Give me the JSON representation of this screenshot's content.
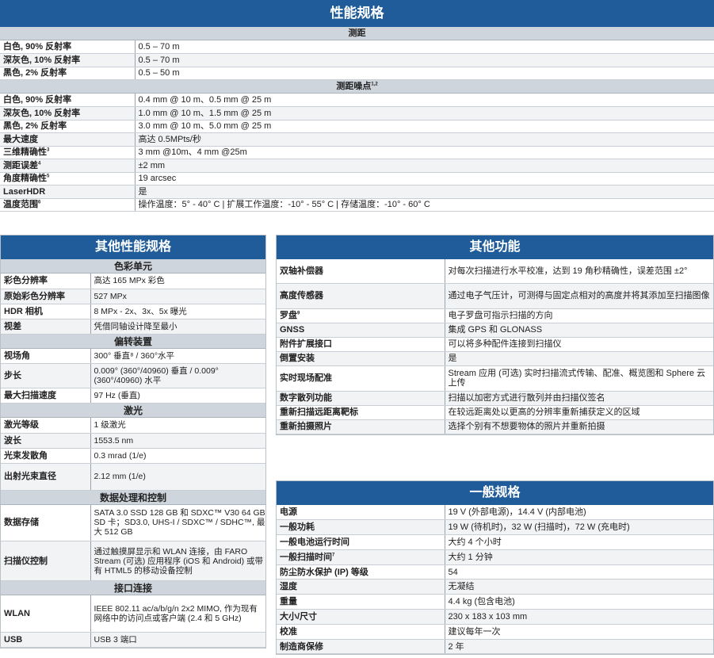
{
  "performance": {
    "title": "性能规格",
    "range_header": "测距",
    "range_rows": [
      {
        "k": "白色, 90% 反射率",
        "v": "0.5 – 70 m"
      },
      {
        "k": "深灰色, 10% 反射率",
        "v": "0.5 – 70 m"
      },
      {
        "k": "黑色, 2% 反射率",
        "v": "0.5 – 50 m"
      }
    ],
    "noise_header": "测距噪点",
    "noise_sup": "1,2",
    "noise_rows": [
      {
        "k": "白色, 90% 反射率",
        "v": "0.4 mm @ 10 m、0.5 mm @ 25 m"
      },
      {
        "k": "深灰色, 10% 反射率",
        "v": "1.0 mm @ 10 m、1.5 mm @ 25 m"
      },
      {
        "k": "黑色, 2% 反射率",
        "v": "3.0 mm @ 10 m、5.0 mm @ 25 m"
      }
    ],
    "misc_rows": [
      {
        "k": "最大速度",
        "sup": "",
        "v": "高达 0.5MPts/秒"
      },
      {
        "k": "三维精确性",
        "sup": "3",
        "v": "3 mm @10m、4 mm @25m"
      },
      {
        "k": "测距误差",
        "sup": "4",
        "v": "±2 mm"
      },
      {
        "k": "角度精确性",
        "sup": "5",
        "v": "19 arcsec"
      },
      {
        "k": "LaserHDR",
        "sup": "",
        "v": "是"
      },
      {
        "k": "温度范围",
        "sup": "6",
        "v": "操作温度：5° - 40° C | 扩展工作温度：-10° - 55° C | 存储温度：-10° - 60° C"
      }
    ]
  },
  "other_perf": {
    "title": "其他性能规格",
    "sections": [
      {
        "header": "色彩单元",
        "rows": [
          {
            "k": "彩色分辨率",
            "v": "高达 165 MPx 彩色"
          },
          {
            "k": "原始彩色分辨率",
            "v": "527 MPx"
          },
          {
            "k": "HDR 相机",
            "v": "8 MPx - 2x、3x、5x 曝光"
          },
          {
            "k": "视差",
            "v": "凭借同轴设计降至最小"
          }
        ]
      },
      {
        "header": "偏转装置",
        "rows": [
          {
            "k": "视场角",
            "v": "300° 垂直⁸ / 360°水平"
          },
          {
            "k": "步长",
            "v": "0.009° (360°/40960) 垂直 / 0.009° (360°/40960) 水平"
          },
          {
            "k": "最大扫描速度",
            "v": "97 Hz (垂直)"
          }
        ]
      },
      {
        "header": "激光",
        "rows": [
          {
            "k": "激光等级",
            "v": "1 级激光"
          },
          {
            "k": "波长",
            "v": "1553.5 nm"
          },
          {
            "k": "光束发散角",
            "v": "0.3 mrad (1/e)"
          },
          {
            "k": "出射光束直径",
            "v": "2.12 mm (1/e)"
          }
        ]
      },
      {
        "header": "数据处理和控制",
        "rows": [
          {
            "k": "数据存储",
            "v": "SATA 3.0 SSD 128 GB 和 SDXC™ V30 64 GB SD 卡；SD3.0, UHS-I / SDXC™ / SDHC™, 最大 512 GB"
          },
          {
            "k": "扫描仪控制",
            "v": "通过触摸屏显示和 WLAN 连接，由 FARO Stream (可选) 应用程序 (iOS 和 Android) 或带有 HTML5 的移动设备控制"
          }
        ]
      },
      {
        "header": "接口连接",
        "rows": [
          {
            "k": "WLAN",
            "v": "IEEE 802.11 ac/a/b/g/n 2x2 MIMO, 作为现有网络中的访问点或客户端 (2.4 和 5 GHz)"
          },
          {
            "k": "USB",
            "v": "USB 3 端口"
          }
        ]
      }
    ]
  },
  "other_features": {
    "title": "其他功能",
    "rows": [
      {
        "k": "双轴补偿器",
        "sup": "",
        "v": "对每次扫描进行水平校准，达到 19 角秒精确性，误差范围 ±2°"
      },
      {
        "k": "高度传感器",
        "sup": "",
        "v": "通过电子气压计，可测得与固定点相对的高度并将其添加至扫描图像"
      },
      {
        "k": "罗盘",
        "sup": "9",
        "v": "电子罗盘可指示扫描的方向"
      },
      {
        "k": "GNSS",
        "sup": "",
        "v": "集成 GPS 和 GLONASS"
      },
      {
        "k": "附件扩展接口",
        "sup": "",
        "v": "可以将多种配件连接到扫描仪"
      },
      {
        "k": "倒置安装",
        "sup": "",
        "v": "是"
      },
      {
        "k": "实时现场配准",
        "sup": "",
        "v": "Stream 应用 (可选) 实时扫描流式传输、配准、概览图和 Sphere 云上传"
      },
      {
        "k": "数字散列功能",
        "sup": "",
        "v": "扫描以加密方式进行散列并由扫描仪签名"
      },
      {
        "k": "重新扫描远距离靶标",
        "sup": "",
        "v": "在较远距离处以更高的分辨率重新捕获定义的区域"
      },
      {
        "k": "重新拍摄照片",
        "sup": "",
        "v": "选择个别有不想要物体的照片并重新拍摄"
      }
    ]
  },
  "general": {
    "title": "一般规格",
    "rows": [
      {
        "k": "电源",
        "sup": "",
        "v": "19 V (外部电源)，14.4 V (内部电池)"
      },
      {
        "k": "一般功耗",
        "sup": "",
        "v": "19 W (待机时)，32 W (扫描时)，72 W (充电时)"
      },
      {
        "k": "一般电池运行时间",
        "sup": "",
        "v": "大约 4 个小时"
      },
      {
        "k": "一般扫描时间",
        "sup": "7",
        "v": "大约 1 分钟"
      },
      {
        "k": "防尘防水保护 (IP) 等级",
        "sup": "",
        "v": "54"
      },
      {
        "k": "湿度",
        "sup": "",
        "v": "无凝结"
      },
      {
        "k": "重量",
        "sup": "",
        "v": "4.4 kg (包含电池)"
      },
      {
        "k": "大小/尺寸",
        "sup": "",
        "v": "230 x 183 x 103 mm"
      },
      {
        "k": "校准",
        "sup": "",
        "v": "建议每年一次"
      },
      {
        "k": "制造商保修",
        "sup": "",
        "v": "2 年"
      }
    ]
  }
}
